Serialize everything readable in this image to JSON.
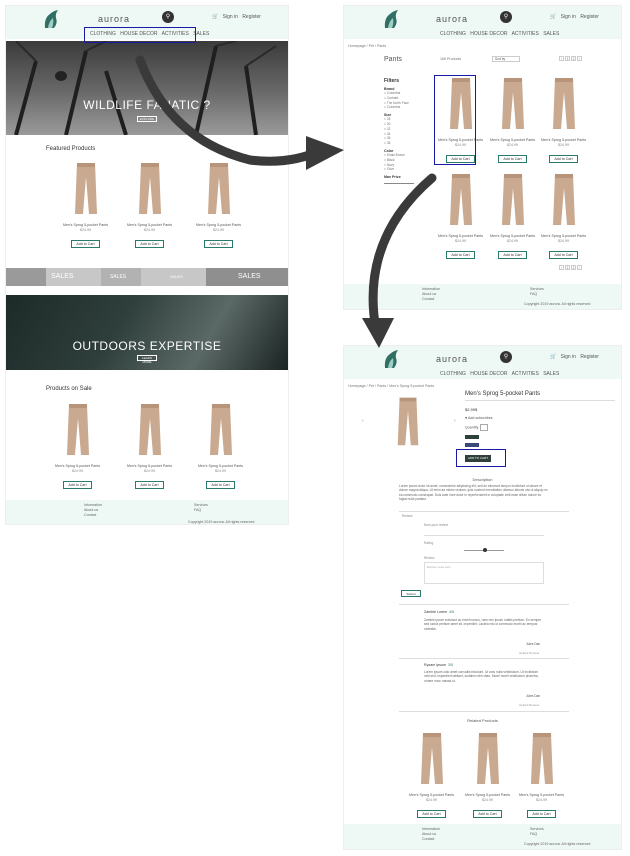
{
  "header": {
    "brand": "aurora",
    "search_icon": "search-icon",
    "cart_icon": "cart-icon",
    "signin": "Sign in",
    "register": "Register",
    "nav": [
      "CLOTHING",
      "HOUSE DECOR",
      "ACTIVITIES",
      "SALES"
    ]
  },
  "home": {
    "hero_title": "WILDLIFE FANATIC ?",
    "hero_button": "EXPLORE",
    "featured_title": "Featured Products",
    "sales_banner": [
      "SALES",
      "SALES",
      "SALES",
      "SALES"
    ],
    "hero2_title": "OUTDOORS EXPERTISE",
    "hero2_button": "LEARN MORE",
    "sale_title": "Products on Sale"
  },
  "product": {
    "name": "Men's Sprog 5-pocket Pants",
    "price": "$24.99",
    "add_to_cart": "Add to Cart"
  },
  "footer": {
    "information": "Information",
    "about": "About us",
    "contact": "Contact",
    "services": "Services",
    "faq": "FAQ",
    "copyright": "Copyright 2019 aurora. All rights reserved"
  },
  "listing": {
    "breadcrumb": "Homepage / Pet / Pants",
    "title": "Pants",
    "count": "166 Products",
    "sort": "Sort by",
    "filters_title": "Filters",
    "brand_label": "Brand",
    "brands": [
      "Columbia",
      "Carhartt",
      "The North Face",
      "Columbia"
    ],
    "size_label": "Size",
    "sizes": [
      "28",
      "30",
      "32",
      "34",
      "36",
      "38"
    ],
    "color_label": "Color",
    "colors": [
      "Khaki Brown",
      "Black",
      "Navy",
      "Olive"
    ],
    "price_label": "Max Price"
  },
  "detail": {
    "breadcrumb": "Homepage / Pet / Pants / Men's Sprog 5-pocket Pants",
    "title": "Men's Sprog 5-pocket Pants",
    "price": "$2.99$",
    "stock": "Add subscribes",
    "quantity": "Quantity",
    "add_button": "ADD TO CART",
    "description_title": "Description",
    "description": "Lorem ipsum dolor sit amet, consectetur adipiscing elit, sed do eiusmod tempor incididunt ut labore et dolore magna aliqua. Ut enim ad minim veniam, quis nostrud exercitation ullamco laboris nisi ut aliquip ex ea commodo consequat. Duis aute irure dolor in reprehenderit in voluptate velit esse cillum dolore eu fugiat nulla pariatur.",
    "review_label": "Review",
    "review_name": "Nom pour review",
    "review_rating": "Rating",
    "review_text": "Review",
    "review_placeholder": "Ecrivez votre avis",
    "submit": "Submit",
    "reviews": [
      {
        "name": "Zamble Lorem",
        "tag": "4/5",
        "text": "Zamble ipsum euismod ac erat rhoncus, nam nec ipsum mattis pretium. Ex semper sed luctus pretium amet sit, imperdiet. Lacinia nisi ut commodo morbi ac tempus molestie.",
        "by": "Jules Dan",
        "help": "Helpful Review"
      },
      {
        "name": "Ryzam Ipsum",
        "tag": "3/5",
        "text": "Lorem ipsum odio amet convallis tincidunt. Ut cras nulla vestibulum. Ut incididunt velit sed, imperdiet habitant, sodales nibh vitae. Morbi morbi vestibulum pharetra, ornare nunc massa ut.",
        "by": "Jules Dan",
        "help": "Helpful Review"
      }
    ],
    "related_title": "Related Products",
    "related_name": "Men's Sprog 5-pocket Pants"
  },
  "colors": {
    "header_bg": "#eef8f4",
    "accent": "#2a7a6b",
    "highlight": "#1a1aa8"
  }
}
